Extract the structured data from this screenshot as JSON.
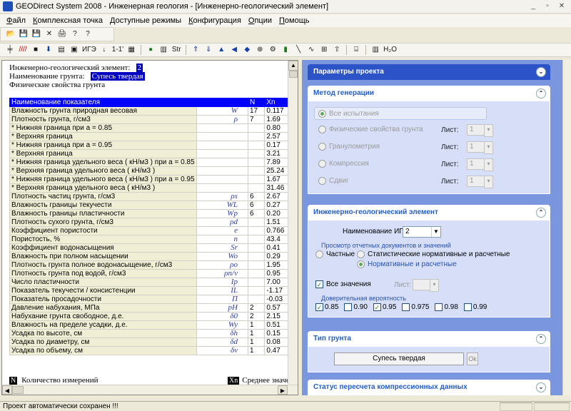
{
  "window": {
    "title": "GEODirect System 2008 - Инженерная геология - [Инженерно-геологический элемент]",
    "controls": [
      "_",
      "▫",
      "✕"
    ]
  },
  "menu": [
    "Файл",
    "Комплексная точка",
    "Доступные режимы",
    "Конфигурация",
    "Опции",
    "Помощь"
  ],
  "toolbar1": [
    "📂",
    "💾",
    "💾",
    "✕",
    "🖨",
    "?",
    "?"
  ],
  "toolbar2": [
    "╪",
    "////",
    "■",
    "⬇",
    "▤",
    "▣",
    "ИГЭ",
    "↓",
    "1-1'",
    "▦",
    "●",
    "▥",
    "Str",
    "⇑",
    "⇓",
    "▲",
    "◀",
    "◆",
    "⊕",
    "⚙",
    "▮",
    "╲",
    "∿",
    "⊞",
    "⇧",
    "⌸",
    "▥",
    "H₂O"
  ],
  "left": {
    "ige_label": "Инженерно-геологический элемент:",
    "ige_value": "2",
    "ground_label": "Наименование грунта:",
    "ground_value": "Супесь твердая",
    "section": "Физические свойства грунта",
    "table_header": [
      "Наименование показателя",
      "",
      "N",
      "Xn"
    ],
    "rows": [
      {
        "name": "Влажность грунта природная весовая",
        "sym": "W",
        "n": "17",
        "x": "0.117"
      },
      {
        "name": "Плотность грунта, г/см3",
        "sym": "ρ",
        "n": "7",
        "x": "1.69"
      },
      {
        "name": "* Нижняя граница при a = 0.85",
        "sym": "",
        "n": "",
        "x": "0.80"
      },
      {
        "name": "* Верхняя граница",
        "sym": "",
        "n": "",
        "x": "2.57"
      },
      {
        "name": "* Нижняя граница при a = 0.95",
        "sym": "",
        "n": "",
        "x": "0.17"
      },
      {
        "name": "* Верхняя граница",
        "sym": "",
        "n": "",
        "x": "3.21"
      },
      {
        "name": "* Нижняя граница удельного веса ( кН/м3 ) при a = 0.85",
        "sym": "",
        "n": "",
        "x": "7.89"
      },
      {
        "name": "* Верхняя граница удельного веса ( кН/м3 )",
        "sym": "",
        "n": "",
        "x": "25.24"
      },
      {
        "name": "* Нижняя граница удельного веса ( кН/м3 ) при a = 0.95",
        "sym": "",
        "n": "",
        "x": "1.67"
      },
      {
        "name": "* Верхняя граница удельного веса ( кН/м3 )",
        "sym": "",
        "n": "",
        "x": "31.46"
      },
      {
        "name": "Плотность частиц грунта, г/см3",
        "sym": "ρs",
        "n": "6",
        "x": "2.67"
      },
      {
        "name": "Влажность границы текучести",
        "sym": "WL",
        "n": "6",
        "x": "0.27"
      },
      {
        "name": "Влажность границы пластичности",
        "sym": "Wp",
        "n": "6",
        "x": "0.20"
      },
      {
        "name": "Плотность сухого грунта, г/см3",
        "sym": "ρd",
        "n": "",
        "x": "1.51"
      },
      {
        "name": "Коэффициент пористости",
        "sym": "e",
        "n": "",
        "x": "0.766"
      },
      {
        "name": "Пористость, %",
        "sym": "n",
        "n": "",
        "x": "43.4"
      },
      {
        "name": "Коэффициент водонасыщения",
        "sym": "Sr",
        "n": "",
        "x": "0.41"
      },
      {
        "name": "Влажность при полном насыщении",
        "sym": "Wo",
        "n": "",
        "x": "0.29"
      },
      {
        "name": "Плотность грунта полное водонасыщение, г/см3",
        "sym": "ρo",
        "n": "",
        "x": "1.95"
      },
      {
        "name": "Плотность грунта под водой, г/см3",
        "sym": "ρn/v",
        "n": "",
        "x": "0.95"
      },
      {
        "name": "Число пластичности",
        "sym": "Ip",
        "n": "",
        "x": "7.00"
      },
      {
        "name": "Показатель текучести / консистенции",
        "sym": "IL",
        "n": "",
        "x": "-1.17"
      },
      {
        "name": "Показатель просадочности",
        "sym": "П",
        "n": "",
        "x": "-0.03"
      },
      {
        "name": "Давление набухания, МПа",
        "sym": "pH",
        "n": "2",
        "x": "0.57"
      },
      {
        "name": "Набухание грунта свободное, д.е.",
        "sym": "δ0",
        "n": "2",
        "x": "2.15"
      },
      {
        "name": "Влажность на пределе усадки, д.е.",
        "sym": "Wy",
        "n": "1",
        "x": "0.51"
      },
      {
        "name": "Усадка по высоте, см",
        "sym": "δh",
        "n": "1",
        "x": "0.15"
      },
      {
        "name": "Усадка по диаметру, см",
        "sym": "δd",
        "n": "1",
        "x": "0.08"
      },
      {
        "name": "Усадка по объему, см",
        "sym": "δv",
        "n": "1",
        "x": "0.47"
      }
    ],
    "legend_n_key": "N",
    "legend_n_text": "Количество измерений",
    "legend_x_key": "Xn",
    "legend_x_text": "Среднее значе"
  },
  "right": {
    "project_params": "Параметры проекта",
    "gen_method": "Метод генерации",
    "gen_options": [
      "Все испытания",
      "Физические свойства грунта",
      "Гранулометрия",
      "Компрессия",
      "Сдвиг"
    ],
    "sheet_label": "Лист:",
    "sheet_value": "1",
    "ige_panel": "Инженерно-геологический элемент",
    "ige_name_label": "Наименование ИГЭ",
    "ige_name_value": "2",
    "view_label": "Просмотр отчетных документов и значений",
    "view_opt1": "Частные",
    "view_opt2": "Статистические нормативные и расчетные",
    "view_opt3": "Нормативные и расчетные",
    "all_values": "Все значения",
    "sheet2_label": "Лист:",
    "conf_label": "Доверительная вероятность",
    "conf_values": [
      {
        "v": "0.85",
        "on": true
      },
      {
        "v": "0.90",
        "on": false
      },
      {
        "v": "0.95",
        "on": true
      },
      {
        "v": "0.975",
        "on": false
      },
      {
        "v": "0.98",
        "on": false
      },
      {
        "v": "0.99",
        "on": false
      }
    ],
    "ground_type": "Тип грунта",
    "ground_type_value": "Супесь твердая",
    "ok": "Ok",
    "status_panel": "Статус пересчета компрессионных данных"
  },
  "status": "Проект автоматически сохранен !!!"
}
